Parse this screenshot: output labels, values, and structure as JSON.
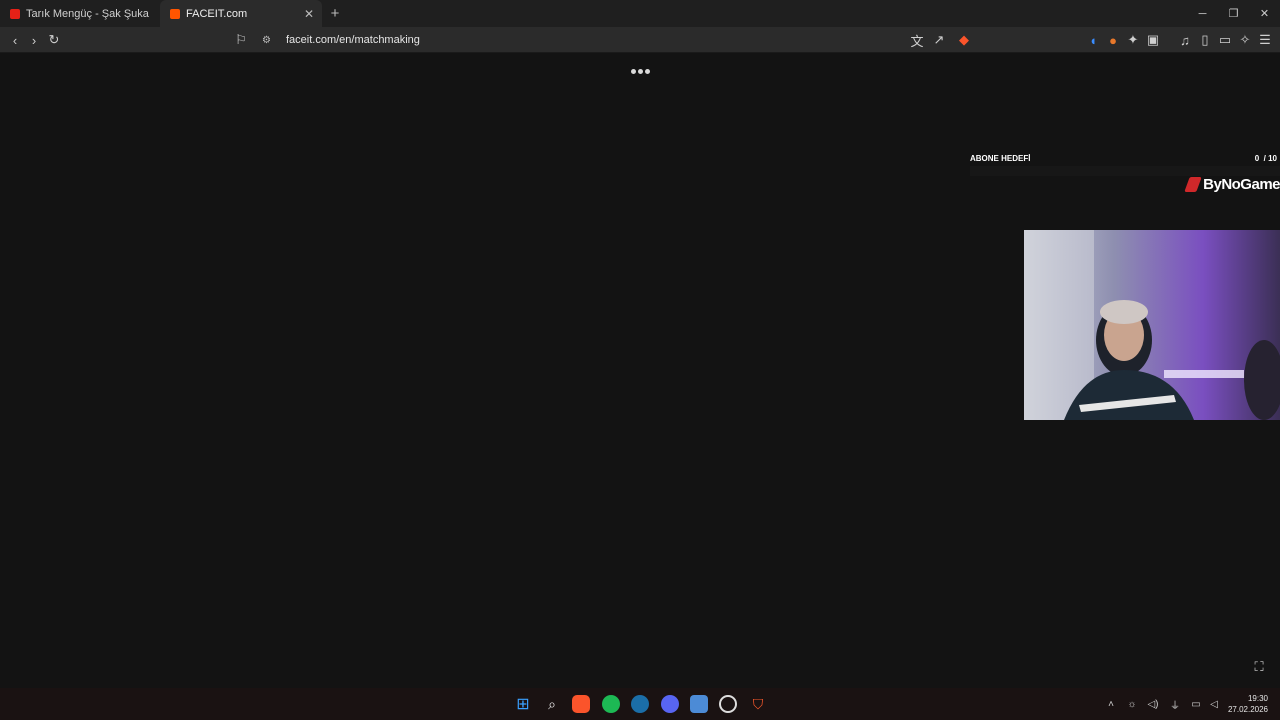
{
  "browser": {
    "tabs": [
      {
        "title": "Tarık Mengüç - Şak Şuka - YouTube",
        "favicon_color": "#e62117",
        "active": false
      },
      {
        "title": "FACEIT.com",
        "favicon_color": "#ff5500",
        "active": true
      }
    ],
    "new_tab_label": "+",
    "url": "faceit.com/en/matchmaking"
  },
  "stream_overlay": {
    "goal_label": "ABONE HEDEFİ",
    "goal_current": "0",
    "goal_target": "/ 10",
    "brand_name": "ByNoGame",
    "brand_color": "#d0282a"
  },
  "taskbar": {
    "time": "19:30",
    "date": "27.02.2026",
    "apps": [
      "windows-start",
      "search",
      "brave",
      "spotify",
      "steam",
      "discord",
      "network-app",
      "obs",
      "faceit-ac"
    ]
  },
  "colors": {
    "page_bg": "#131313",
    "toolbar_bg": "#2b2b2b",
    "tabbar_bg": "#1f1f1f"
  }
}
